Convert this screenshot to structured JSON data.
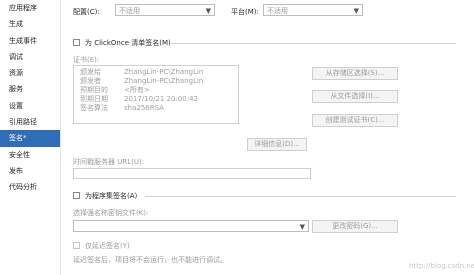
{
  "sidebar": {
    "items": [
      {
        "label": "应用程序",
        "selected": false
      },
      {
        "label": "生成",
        "selected": false
      },
      {
        "label": "生成事件",
        "selected": false
      },
      {
        "label": "调试",
        "selected": false
      },
      {
        "label": "资源",
        "selected": false
      },
      {
        "label": "服务",
        "selected": false
      },
      {
        "label": "设置",
        "selected": false
      },
      {
        "label": "引用路径",
        "selected": false
      },
      {
        "label": "签名*",
        "selected": true
      },
      {
        "label": "安全性",
        "selected": false
      },
      {
        "label": "发布",
        "selected": false
      },
      {
        "label": "代码分析",
        "selected": false
      }
    ]
  },
  "config": {
    "config_label": "配置(C):",
    "config_value": "不适用",
    "platform_label": "平台(M):",
    "platform_value": "不适用"
  },
  "clickonce": {
    "checkbox_label": "为 ClickOnce 清单签名(M)",
    "cert_label": "证书(E):",
    "cert": {
      "issued_to_key": "颁发给",
      "issued_to": "ZhangLin-PC\\ZhangLin",
      "issued_by_key": "颁发者",
      "issued_by": "ZhangLin-PC\\ZhangLin",
      "purpose_key": "预期目的",
      "purpose": "<所有>",
      "expires_key": "到期日期",
      "expires": "2017/10/21 20:00:42",
      "algorithm_key": "签名算法",
      "algorithm": "sha256RSA"
    },
    "btn_from_store": "从存储区选择(S)...",
    "btn_from_file": "从文件选择(I)...",
    "btn_create_test": "创建测试证书(C)...",
    "btn_details": "详细信息(D)...",
    "timestamp_label": "时间戳服务器 URL(U):",
    "timestamp_value": ""
  },
  "assembly": {
    "checkbox_label": "为程序集签名(A)",
    "keyfile_label": "选择强名称密钥文件(K):",
    "keyfile_value": "",
    "btn_change_password": "更改密码(G)...",
    "delay_label": "仅延迟签名(Y)",
    "delay_note": "延迟签名后，项目将不会运行，也不能进行调试。"
  },
  "watermark": "http://blog.csdn.net/"
}
